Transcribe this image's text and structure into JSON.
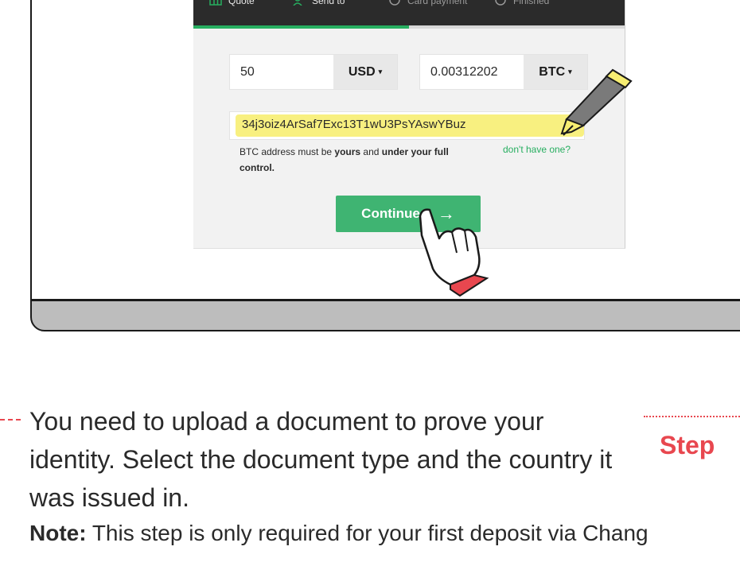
{
  "steps": [
    {
      "label": "Quote",
      "icon": "grid-icon"
    },
    {
      "label": "Send to",
      "icon": "user-add-icon"
    },
    {
      "label": "Card payment",
      "icon": "card-icon"
    },
    {
      "label": "Finished",
      "icon": "check-circle-icon"
    }
  ],
  "progress": 0.5,
  "exchange": {
    "send_amount": "50",
    "send_currency": "USD",
    "receive_amount": "0.00312202",
    "receive_currency": "BTC"
  },
  "address": {
    "value": "34j3oiz4ArSaf7Exc13T1wU3PsYAswYBuz",
    "hint_prefix": "BTC address must be ",
    "hint_bold1": "yours",
    "hint_mid": " and ",
    "hint_bold2": "under your full control.",
    "help_link": "don't have one?"
  },
  "continue_label": "Continue",
  "caption": "You need to upload a document to prove your identity. Select the document type and the country it was issued in.",
  "note_label": "Note:",
  "note_text": " This step is only required for your first deposit via Chang",
  "step_label": "Step",
  "colors": {
    "accent": "#27ae60",
    "button": "#3fb472",
    "highlight": "#f7ee72",
    "step_red": "#e8474f"
  }
}
